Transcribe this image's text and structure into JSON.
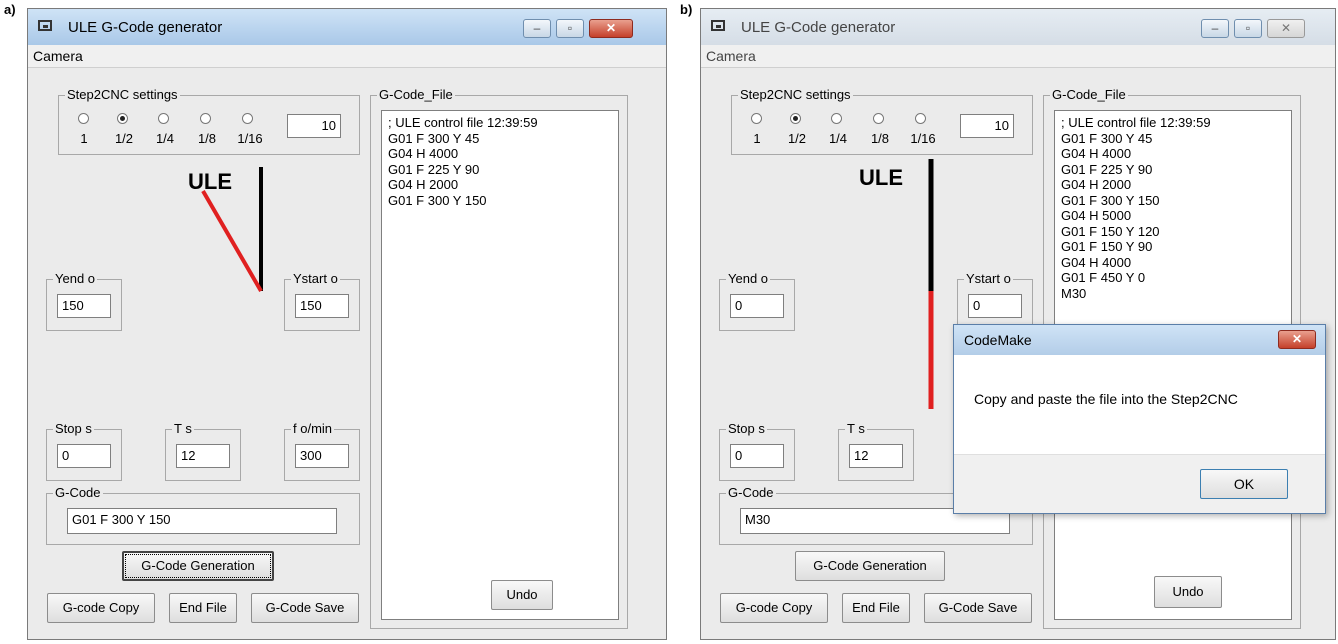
{
  "panel_labels": {
    "a": "a)",
    "b": "b)"
  },
  "window": {
    "title": "ULE G-Code generator",
    "menu": "Camera"
  },
  "step2cnc": {
    "title": "Step2CNC settings",
    "options": [
      "1",
      "1/2",
      "1/4",
      "1/8",
      "1/16"
    ],
    "selected_index": 1,
    "value": "10"
  },
  "ule_label": "ULE",
  "gcode_file_title": "G-Code_File",
  "field_labels": {
    "yend": "Yend o",
    "ystart": "Ystart o",
    "stop": "Stop s",
    "t": "T s",
    "f": "f o/min",
    "gcode": "G-Code"
  },
  "buttons": {
    "generation": "G-Code Generation",
    "copy": "G-code Copy",
    "end_file": "End File",
    "save": "G-Code Save",
    "undo": "Undo"
  },
  "panel_a": {
    "yend": "150",
    "ystart": "150",
    "stop": "0",
    "t": "12",
    "f": "300",
    "gcode": "G01 F 300 Y 150",
    "file_lines": [
      "; ULE control file 12:39:59",
      "G01 F 300 Y 45",
      "G04 H 4000",
      "G01 F 225 Y 90",
      "G04 H 2000",
      "G01 F 300 Y 150"
    ]
  },
  "panel_b": {
    "yend": "0",
    "ystart": "0",
    "stop": "0",
    "t": "12",
    "gcode": "M30",
    "file_lines": [
      "; ULE control file 12:39:59",
      "G01 F 300 Y 45",
      "G04 H 4000",
      "G01 F 225 Y 90",
      "G04 H 2000",
      "G01 F 300 Y 150",
      "G04 H 5000",
      "G01 F 150 Y 120",
      "G01 F 150 Y 90",
      "G04 H 4000",
      "G01 F 450 Y 0",
      "M30"
    ]
  },
  "dialog": {
    "title": "CodeMake",
    "message": "Copy and paste the file into the Step2CNC",
    "ok": "OK"
  },
  "colors": {
    "red_line": "#e02020",
    "black_line": "#000000"
  }
}
